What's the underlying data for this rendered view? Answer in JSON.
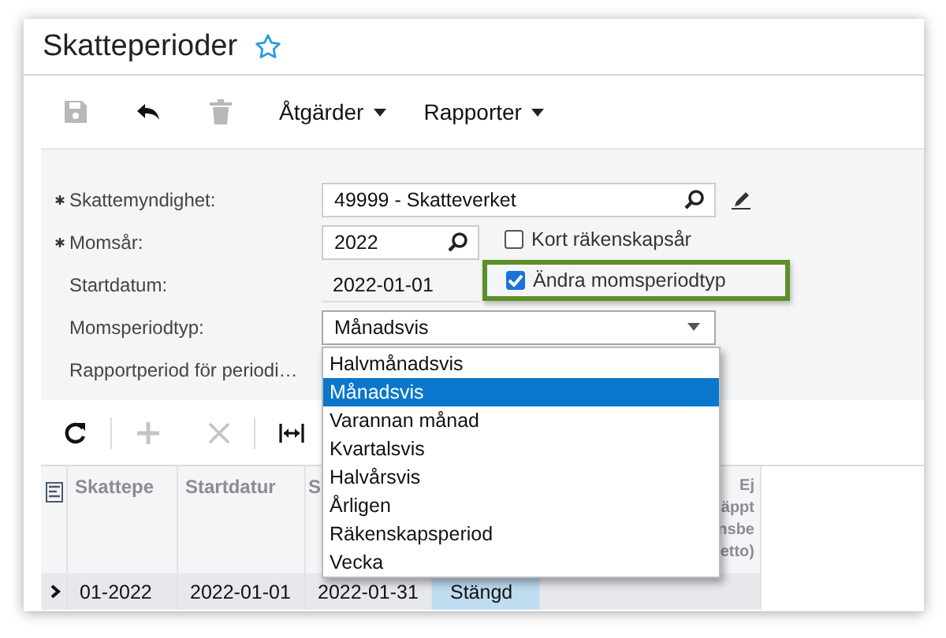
{
  "page": {
    "title": "Skatteperioder",
    "favorite": false
  },
  "toolbar": [
    {
      "kind": "save",
      "disabled": true
    },
    {
      "kind": "undo",
      "disabled": false
    },
    {
      "kind": "delete",
      "disabled": true
    },
    {
      "kind": "menu",
      "label": "Åtgärder"
    },
    {
      "kind": "menu",
      "label": "Rapporter"
    }
  ],
  "form": {
    "tax_agency": {
      "label": "Skattemyndighet:",
      "required": true,
      "value": "49999 - Skatteverket"
    },
    "tax_year": {
      "label": "Momsår:",
      "required": true,
      "value": "2022"
    },
    "short_year": {
      "label": "Kort räkenskapsår",
      "checked": false
    },
    "change_type": {
      "label": "Ändra momsperiodtyp",
      "checked": true,
      "highlighted": true
    },
    "start_date": {
      "label": "Startdatum:",
      "value": "2022-01-01"
    },
    "period_type": {
      "label": "Momsperiodtyp:",
      "value": "Månadsvis",
      "expanded": true,
      "options": [
        {
          "label": "Halvmånadsvis",
          "selected": false
        },
        {
          "label": "Månadsvis",
          "selected": true
        },
        {
          "label": "Varannan månad",
          "selected": false
        },
        {
          "label": "Kvartalsvis",
          "selected": false
        },
        {
          "label": "Halvårsvis",
          "selected": false
        },
        {
          "label": "Årligen",
          "selected": false
        },
        {
          "label": "Räkenskapsperiod",
          "selected": false
        },
        {
          "label": "Vecka",
          "selected": false
        }
      ]
    },
    "report_period": {
      "label": "Rapportperiod för periodi…"
    }
  },
  "grid_toolbar": [
    {
      "kind": "refresh",
      "disabled": false
    },
    {
      "kind": "add",
      "disabled": true
    },
    {
      "kind": "delete",
      "disabled": true
    },
    {
      "kind": "fit",
      "disabled": false
    }
  ],
  "table": {
    "columns": [
      "Skattepe",
      "Startdatur",
      "S",
      "",
      "Ej\näppt\nnsbe\netto)"
    ],
    "rows": [
      {
        "cells": [
          "01-2022",
          "2022-01-01",
          "2022-01-31",
          "Stängd",
          ""
        ],
        "expanded": false
      }
    ]
  }
}
